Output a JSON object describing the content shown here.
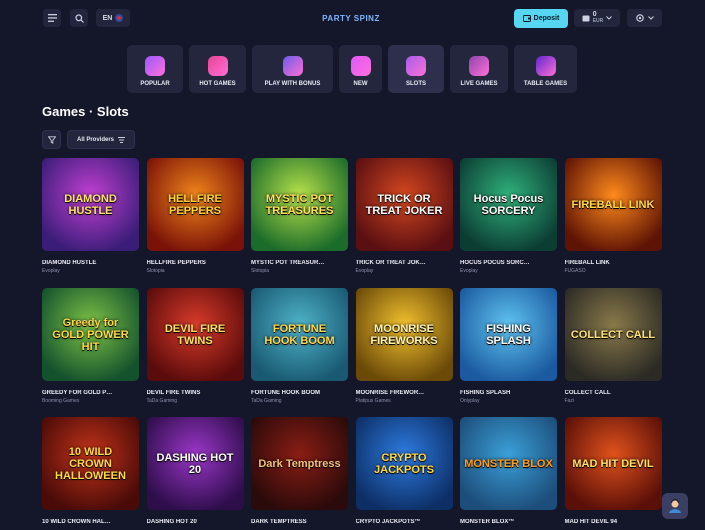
{
  "header": {
    "language": "EN",
    "logo_text": "PARTY SPINZ",
    "deposit_label": "Deposit",
    "balance": "0",
    "currency": "EUR"
  },
  "categories": [
    {
      "label": "POPULAR",
      "icon": "crown-icon",
      "color": "#9b59ff"
    },
    {
      "label": "HOT GAMES",
      "icon": "flame-icon",
      "color": "#e84393"
    },
    {
      "label": "PLAY WITH BONUS",
      "icon": "coin-x2-icon",
      "color": "#6c5ce7"
    },
    {
      "label": "NEW",
      "icon": "new-badge-icon",
      "color": "#e056fd"
    },
    {
      "label": "SLOTS",
      "icon": "slot-machine-icon",
      "color": "#a55eea"
    },
    {
      "label": "LIVE GAMES",
      "icon": "live-phone-icon",
      "color": "#8e44ad"
    },
    {
      "label": "TABLE GAMES",
      "icon": "roulette-icon",
      "color": "#5f27cd"
    }
  ],
  "page": {
    "title": "Games · Slots",
    "providers_label": "All Providers"
  },
  "games": [
    {
      "name": "DIAMOND HUSTLE",
      "provider": "Evoplay",
      "art": "DIAMOND HUSTLE",
      "bg1": "#3a1d78",
      "bg2": "#c13fd1",
      "fg": "#ffe46b"
    },
    {
      "name": "HELLFIRE PEPPERS",
      "provider": "Slotopia",
      "art": "HELLFIRE PEPPERS",
      "bg1": "#7a1208",
      "bg2": "#f0851a",
      "fg": "#ffd23d"
    },
    {
      "name": "MYSTIC POT TREASUR…",
      "provider": "Slotopia",
      "art": "MYSTIC POT TREASURES",
      "bg1": "#1b6b2a",
      "bg2": "#b7e24a",
      "fg": "#ffe05a"
    },
    {
      "name": "TRICK OR TREAT JOK…",
      "provider": "Evoplay",
      "art": "TRICK OR TREAT JOKER",
      "bg1": "#5a0f12",
      "bg2": "#d4471f",
      "fg": "#ffffff"
    },
    {
      "name": "HOCUS POCUS SORC…",
      "provider": "Evoplay",
      "art": "Hocus Pocus SORCERY",
      "bg1": "#0c3d33",
      "bg2": "#2fb27c",
      "fg": "#ffffff"
    },
    {
      "name": "FIREBALL LINK",
      "provider": "FUGASO",
      "art": "FIREBALL LINK",
      "bg1": "#5e1304",
      "bg2": "#ff8a1c",
      "fg": "#ffd84a"
    },
    {
      "name": "GREEDY FOR GOLD P…",
      "provider": "Booming Games",
      "art": "Greedy for GOLD POWER HIT",
      "bg1": "#14512d",
      "bg2": "#7dc346",
      "fg": "#ffd84a"
    },
    {
      "name": "DEVIL FIRE TWINS",
      "provider": "TaDa Gaming",
      "art": "DEVIL FIRE TWINS",
      "bg1": "#5a0b0b",
      "bg2": "#d93b2a",
      "fg": "#ffe066"
    },
    {
      "name": "FORTUNE HOOK BOOM",
      "provider": "TaDa Gaming",
      "art": "FORTUNE HOOK BOOM",
      "bg1": "#195a72",
      "bg2": "#4fb3c9",
      "fg": "#ffd84a"
    },
    {
      "name": "MOONRISE FIREWOR…",
      "provider": "Platipus Games",
      "art": "MOONRISE FIREWORKS",
      "bg1": "#6b4a08",
      "bg2": "#f2c12e",
      "fg": "#fff3b0"
    },
    {
      "name": "FISHING SPLASH",
      "provider": "Onlyplay",
      "art": "FISHING SPLASH",
      "bg1": "#1b5aa0",
      "bg2": "#5fc3f0",
      "fg": "#ffffff"
    },
    {
      "name": "COLLECT CALL",
      "provider": "Fazi",
      "art": "COLLECT CALL",
      "bg1": "#2b2a25",
      "bg2": "#8a7a4a",
      "fg": "#ffe27a"
    },
    {
      "name": "10 WILD CROWN HAL…",
      "provider": "",
      "art": "10 WILD CROWN HALLOWEEN",
      "bg1": "#4a0b08",
      "bg2": "#c2331a",
      "fg": "#ffd84a"
    },
    {
      "name": "DASHING HOT 20",
      "provider": "",
      "art": "DASHING HOT 20",
      "bg1": "#2d0d4a",
      "bg2": "#9b36c8",
      "fg": "#ffffff"
    },
    {
      "name": "DARK TEMPTRESS",
      "provider": "",
      "art": "Dark Temptress",
      "bg1": "#2a0a0a",
      "bg2": "#8a1d14",
      "fg": "#f3c27a"
    },
    {
      "name": "CRYPTO JACKPOTS™",
      "provider": "",
      "art": "CRYPTO JACKPOTS",
      "bg1": "#0d2f66",
      "bg2": "#2d7be0",
      "fg": "#ffd84a"
    },
    {
      "name": "MONSTER BLOX™",
      "provider": "",
      "art": "MONSTER BLOX",
      "bg1": "#1d4d7a",
      "bg2": "#3aa0d8",
      "fg": "#ff9a1c"
    },
    {
      "name": "MAD HIT DEVIL 94",
      "provider": "",
      "art": "MAD HIT DEVIL",
      "bg1": "#5a0f08",
      "bg2": "#e0521c",
      "fg": "#ffe066"
    }
  ]
}
